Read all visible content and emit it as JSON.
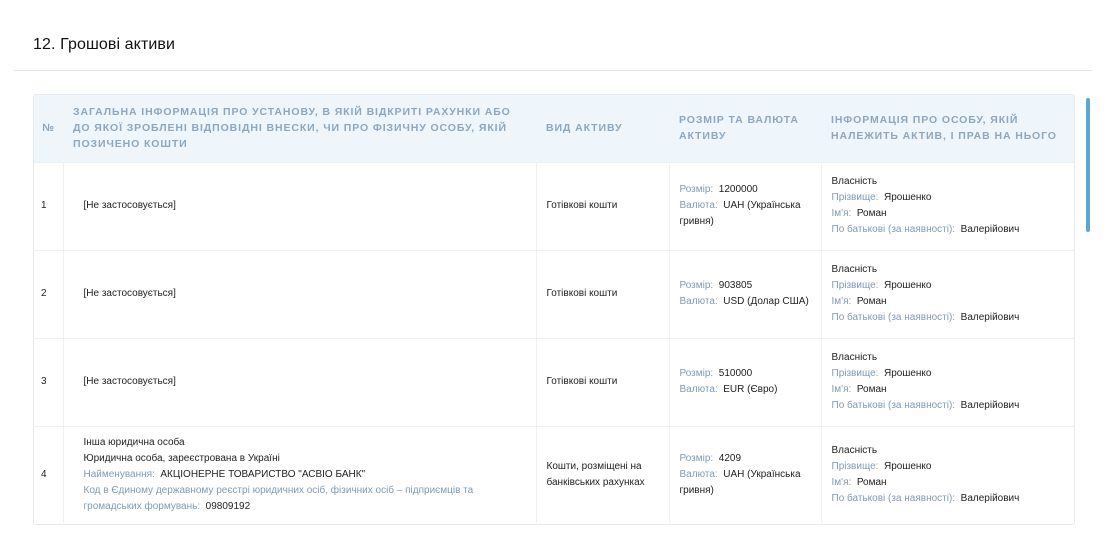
{
  "section": {
    "title": "12. Грошові активи"
  },
  "table": {
    "headers": {
      "num": "№",
      "institution": "Загальна інформація про установу, в якій відкриті рахунки або до якої зроблені відповідні внески, чи про фізичну особу, якій позичено кошти",
      "asset_type": "Вид активу",
      "amount": "Розмір та валюта активу",
      "owner": "Інформація про особу, якій належить актив, і прав на нього"
    },
    "labels": {
      "size": "Розмір:",
      "currency": "Валюта:",
      "ownership": "Власність",
      "surname": "Прізвище:",
      "name": "Ім'я:",
      "patronymic": "По батькові (за наявності):",
      "org_name": "Найменування:",
      "org_code": "Код в Єдиному державному реєстрі юридичних осіб, фізичних осіб – підприємців та громадських формувань:"
    },
    "rows": [
      {
        "num": "1",
        "institution": "[Не застосовується]",
        "asset_type": "Готівкові кошти",
        "size": "1200000",
        "currency": "UAH (Українська гривня)",
        "surname": "Ярошенко",
        "name": "Роман",
        "patronymic": "Валерійович"
      },
      {
        "num": "2",
        "institution": "[Не застосовується]",
        "asset_type": "Готівкові кошти",
        "size": "903805",
        "currency": "USD (Долар США)",
        "surname": "Ярошенко",
        "name": "Роман",
        "patronymic": "Валерійович"
      },
      {
        "num": "3",
        "institution": "[Не застосовується]",
        "asset_type": "Готівкові кошти",
        "size": "510000",
        "currency": "EUR (Євро)",
        "surname": "Ярошенко",
        "name": "Роман",
        "patronymic": "Валерійович"
      },
      {
        "num": "4",
        "institution_line1": "Інша юридична особа",
        "institution_line2": "Юридична особа, зареєстрована в Україні",
        "org_name": "АКЦІОНЕРНЕ ТОВАРИСТВО \"АСВІО БАНК\"",
        "org_code": "09809192",
        "asset_type": "Кошти, розміщені на банківських рахунках",
        "size": "4209",
        "currency": "UAH (Українська гривня)",
        "surname": "Ярошенко",
        "name": "Роман",
        "patronymic": "Валерійович"
      }
    ]
  }
}
